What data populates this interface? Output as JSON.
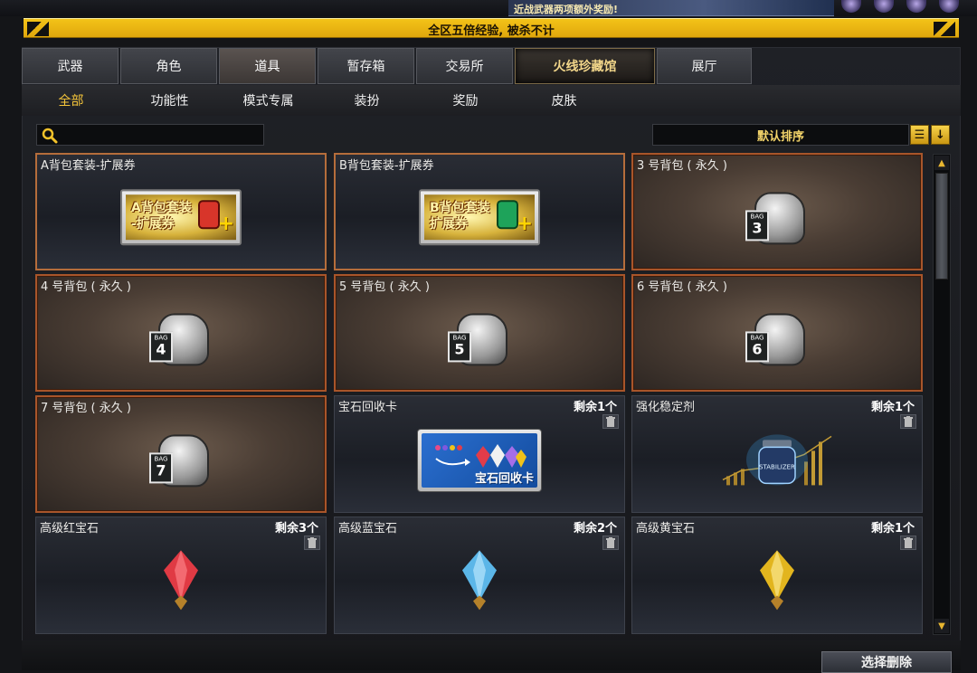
{
  "top": {
    "event_banner": "近战武器两项额外奖励!",
    "notice": "全区五倍经验, 被杀不计"
  },
  "main_tabs": [
    {
      "label": "武器",
      "state": "normal"
    },
    {
      "label": "角色",
      "state": "normal"
    },
    {
      "label": "道具",
      "state": "selected"
    },
    {
      "label": "暂存箱",
      "state": "normal"
    },
    {
      "label": "交易所",
      "state": "normal"
    },
    {
      "label": "火线珍藏馆",
      "state": "special"
    },
    {
      "label": "展厅",
      "state": "normal"
    }
  ],
  "sub_tabs": [
    {
      "label": "全部",
      "selected": true
    },
    {
      "label": "功能性",
      "selected": false
    },
    {
      "label": "模式专属",
      "selected": false
    },
    {
      "label": "装扮",
      "selected": false
    },
    {
      "label": "奖励",
      "selected": false
    },
    {
      "label": "皮肤",
      "selected": false
    }
  ],
  "search": {
    "placeholder": "",
    "value": ""
  },
  "sort": {
    "label": "默认排序"
  },
  "items": [
    {
      "name": "A背包套装-扩展券",
      "kind": "coupon",
      "art_line1": "A背包套装",
      "art_line2": "-扩展券",
      "bag_color": "#d8352a",
      "count": ""
    },
    {
      "name": "B背包套装-扩展券",
      "kind": "coupon",
      "art_line1": "B背包套装",
      "art_line2": "扩展券",
      "bag_color": "#1ea35a",
      "count": ""
    },
    {
      "name": "3 号背包 ( 永久 )",
      "kind": "bag",
      "bag_label": "BAG",
      "bag_number": "3",
      "count": ""
    },
    {
      "name": "4 号背包 ( 永久 )",
      "kind": "bag",
      "bag_label": "BAG",
      "bag_number": "4",
      "count": ""
    },
    {
      "name": "5 号背包 ( 永久 )",
      "kind": "bag",
      "bag_label": "BAG",
      "bag_number": "5",
      "count": ""
    },
    {
      "name": "6 号背包 ( 永久 )",
      "kind": "bag",
      "bag_label": "BAG",
      "bag_number": "6",
      "count": ""
    },
    {
      "name": "7 号背包 ( 永久 )",
      "kind": "bag",
      "bag_label": "BAG",
      "bag_number": "7",
      "count": ""
    },
    {
      "name": "宝石回收卡",
      "kind": "recycle",
      "art_text": "宝石回收卡",
      "count": "剩余1个"
    },
    {
      "name": "强化稳定剂",
      "kind": "stabilizer",
      "art_text": "STABILIZER",
      "count": "剩余1个"
    },
    {
      "name": "高级红宝石",
      "kind": "gem",
      "gem_color": "#e03a44",
      "count": "剩余3个"
    },
    {
      "name": "高级蓝宝石",
      "kind": "gem",
      "gem_color": "#5bb6e8",
      "count": "剩余2个"
    },
    {
      "name": "高级黄宝石",
      "kind": "gem",
      "gem_color": "#e2b51e",
      "count": "剩余1个"
    }
  ],
  "delete_button": "选择删除",
  "colors": {
    "accent": "#f5c53a",
    "bag_border": "#a8552a",
    "notice_bg": "#f0bd16"
  }
}
